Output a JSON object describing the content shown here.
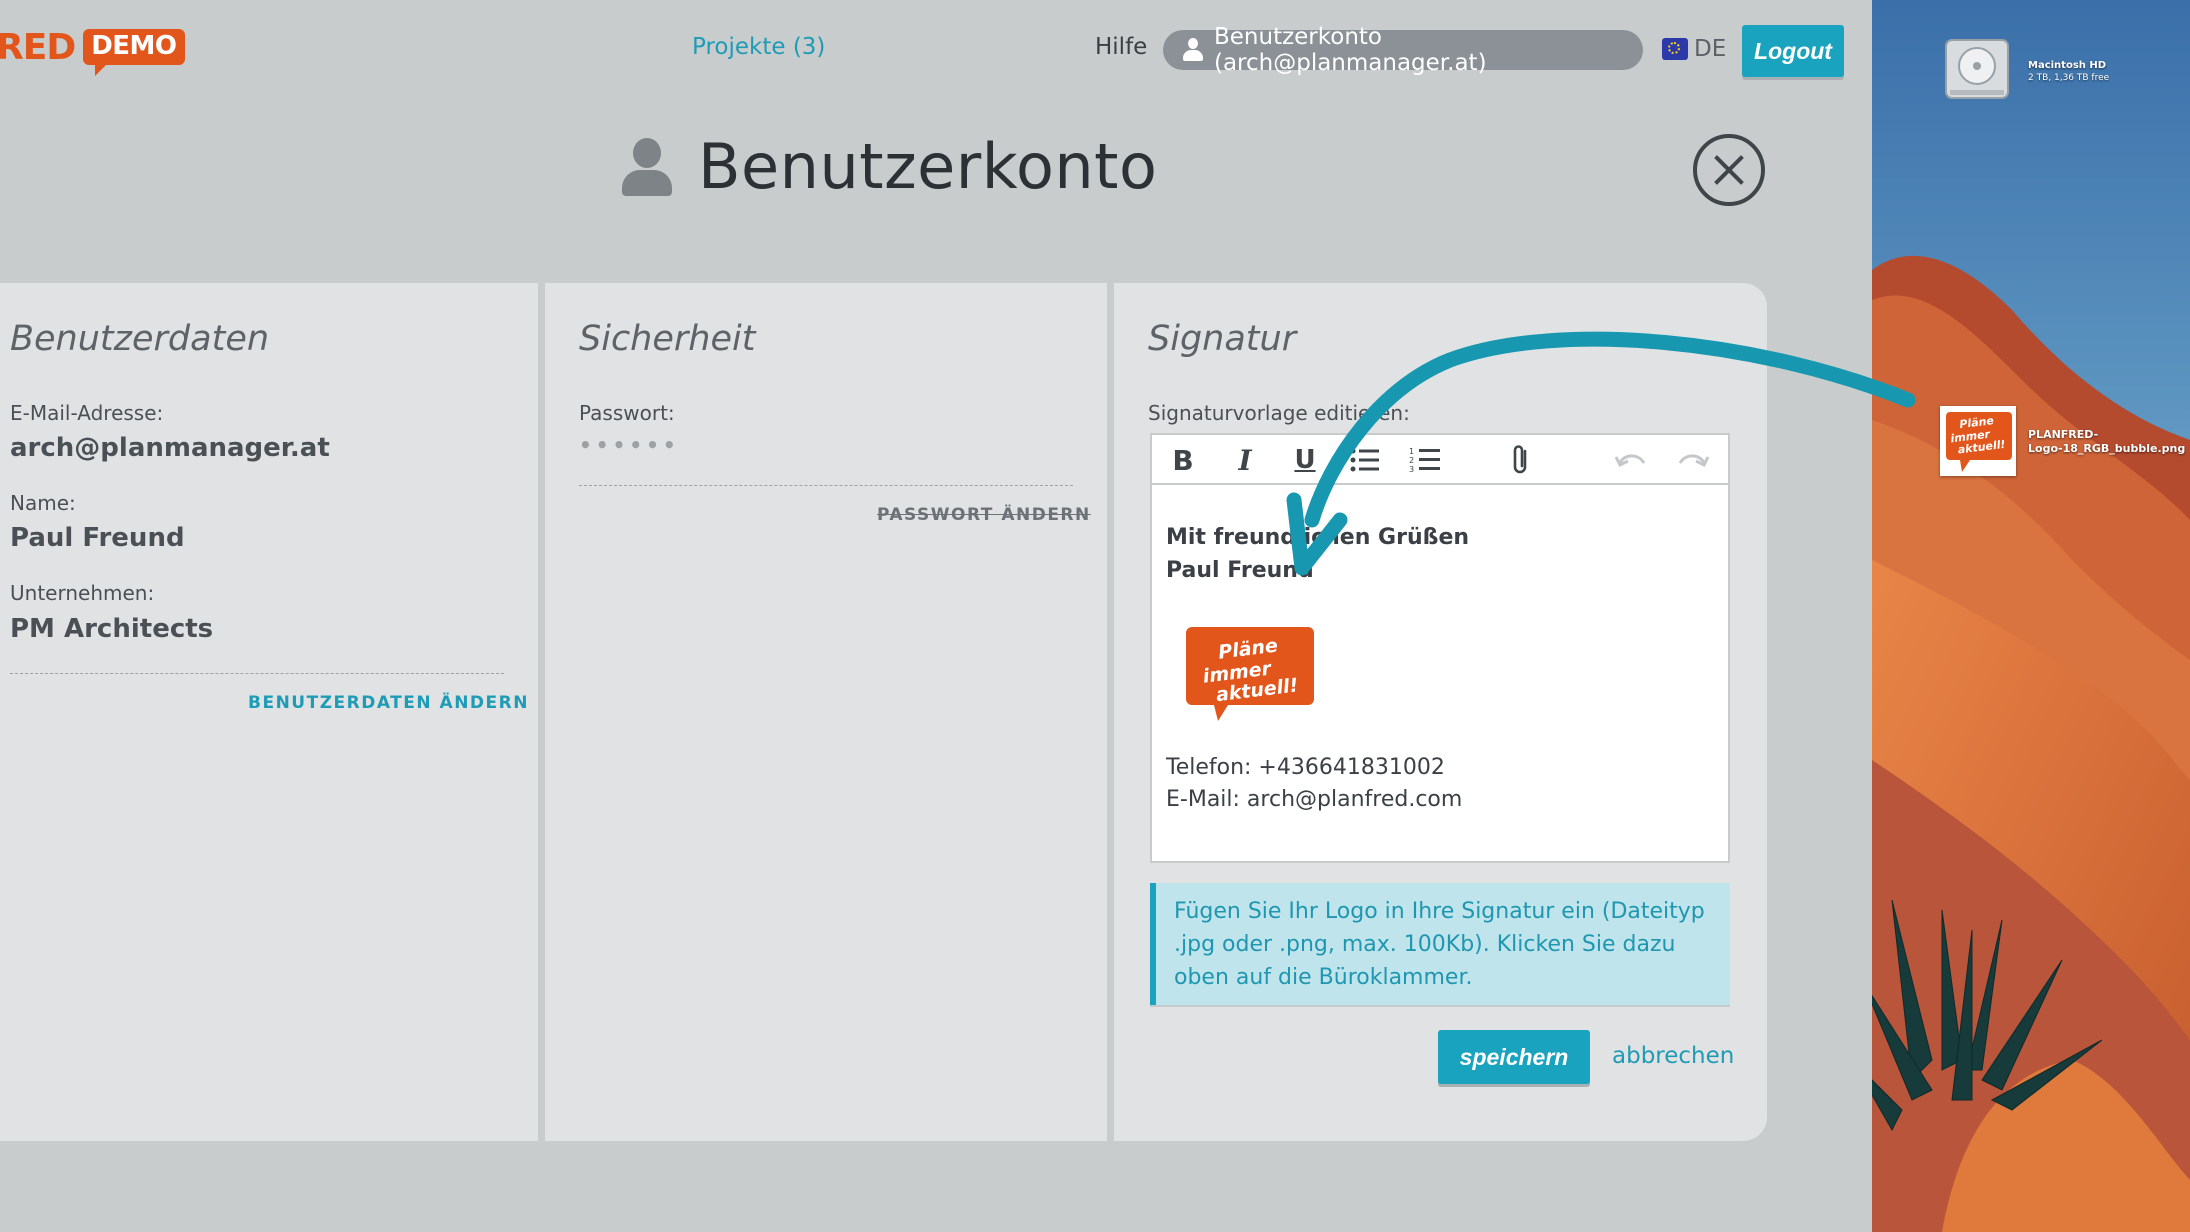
{
  "app": {
    "logo_text": "RED",
    "logo_badge": "DEMO",
    "nav": {
      "projects": "Projekte (3)",
      "help": "Hilfe",
      "account": "Benutzerkonto (arch@planmanager.at)",
      "language": "DE",
      "logout": "Logout"
    },
    "page_title": "Benutzerkonto",
    "panels": {
      "user": {
        "title": "Benutzerdaten",
        "email_label": "E-Mail-Adresse:",
        "email_value": "arch@planmanager.at",
        "name_label": "Name:",
        "name_value": "Paul Freund",
        "company_label": "Unternehmen:",
        "company_value": "PM Architects",
        "edit_link": "BENUTZERDATEN ÄNDERN"
      },
      "security": {
        "title": "Sicherheit",
        "password_label": "Passwort:",
        "password_value": "••••••",
        "change_link": "PASSWORT ÄNDERN"
      },
      "signature": {
        "title": "Signatur",
        "editor_label": "Signaturvorlage editieren:",
        "toolbar": {
          "bold": "B",
          "italic": "I",
          "underline": "U"
        },
        "body": {
          "greeting": "Mit freundlichen Grüßen",
          "name": "Paul Freund",
          "phone": "Telefon: +436641831002",
          "email": "E-Mail: arch@planfred.com"
        },
        "logo_text": [
          "Pläne",
          "immer",
          "aktuell!"
        ],
        "hint": "Fügen Sie Ihr Logo in Ihre Signatur ein (Dateityp .jpg oder .png, max. 100Kb). Klicken Sie dazu oben auf die Büroklammer.",
        "save": "speichern",
        "cancel": "abbrechen"
      }
    }
  },
  "desktop": {
    "disk_name": "Macintosh HD",
    "disk_info": "2 TB, 1,36 TB free",
    "file_name_line1": "PLANFRED-",
    "file_name_line2": "Logo-18_RGB_bubble.png",
    "file_logo_text": [
      "Pläne",
      "immer",
      "aktuell!"
    ]
  },
  "colors": {
    "accent": "#1aa3bf",
    "brand_orange": "#e2561c",
    "arrow": "#1798b0"
  }
}
